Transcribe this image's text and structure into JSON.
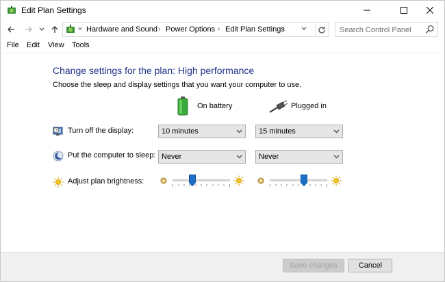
{
  "window": {
    "title": "Edit Plan Settings"
  },
  "nav": {
    "address_prefix": "«",
    "breadcrumbs": [
      "Hardware and Sound",
      "Power Options",
      "Edit Plan Settings"
    ],
    "search_placeholder": "Search Control Panel"
  },
  "menu": [
    "File",
    "Edit",
    "View",
    "Tools"
  ],
  "page": {
    "heading": "Change settings for the plan: High performance",
    "subheading": "Choose the sleep and display settings that you want your computer to use.",
    "columns": {
      "battery": "On battery",
      "plugged": "Plugged in"
    },
    "rows": {
      "display": {
        "label": "Turn off the display:",
        "battery_value": "10 minutes",
        "plugged_value": "15 minutes"
      },
      "sleep": {
        "label": "Put the computer to sleep:",
        "battery_value": "Never",
        "plugged_value": "Never"
      },
      "brightness": {
        "label": "Adjust plan brightness:",
        "battery_level_percent": 35,
        "plugged_level_percent": 60
      }
    }
  },
  "footer": {
    "save_label": "Save changes",
    "cancel_label": "Cancel"
  },
  "colors": {
    "heading": "#1e3287",
    "slider_thumb": "#1c6fc9",
    "battery_green": "#3aa83a"
  }
}
